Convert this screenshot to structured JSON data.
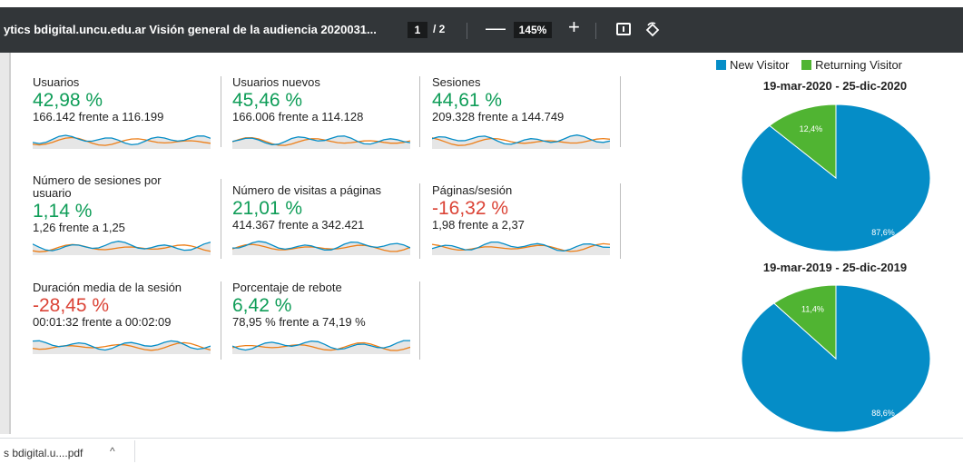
{
  "toolbar": {
    "title": "ytics bdigital.uncu.edu.ar Visión general de la audiencia 2020031...",
    "page_current": "1",
    "page_sep": "/ 2",
    "zoom": "145%",
    "zoom_out": "—",
    "zoom_in": "+"
  },
  "metrics": [
    {
      "label": "Usuarios",
      "pct": "42,98 %",
      "trend": "up",
      "comp": "166.142 frente a 116.199"
    },
    {
      "label": "Usuarios nuevos",
      "pct": "45,46 %",
      "trend": "up",
      "comp": "166.006 frente a 114.128"
    },
    {
      "label": "Sesiones",
      "pct": "44,61 %",
      "trend": "up",
      "comp": "209.328 frente a 144.749"
    },
    {
      "label": "Número de sesiones por usuario",
      "pct": "1,14 %",
      "trend": "up",
      "comp": "1,26 frente a 1,25"
    },
    {
      "label": "Número de visitas a páginas",
      "pct": "21,01 %",
      "trend": "up",
      "comp": "414.367 frente a 342.421"
    },
    {
      "label": "Páginas/sesión",
      "pct": "-16,32 %",
      "trend": "down",
      "comp": "1,98 frente a 2,37"
    },
    {
      "label": "Duración media de la sesión",
      "pct": "-28,45 %",
      "trend": "down",
      "comp": "00:01:32 frente a 00:02:09"
    },
    {
      "label": "Porcentaje de rebote",
      "pct": "6,42 %",
      "trend": "up",
      "comp": "78,95 % frente a 74,19 %"
    }
  ],
  "legend": {
    "new": "New Visitor",
    "returning": "Returning Visitor"
  },
  "colors": {
    "new": "#058dc7",
    "returning": "#50b432",
    "up": "#0f9d58",
    "down": "#db4437",
    "spark_blue": "#058dc7",
    "spark_orange": "#ed7e17"
  },
  "pies": [
    {
      "title": "19-mar-2020 - 25-dic-2020",
      "new": 87.6,
      "returning": 12.4,
      "new_label": "87,6%",
      "returning_label": "12,4%"
    },
    {
      "title": "19-mar-2019 - 25-dic-2019",
      "new": 88.6,
      "returning": 11.4,
      "new_label": "88,6%",
      "returning_label": "11,4%"
    }
  ],
  "download": {
    "filename": "s bdigital.u....pdf",
    "chevron": "^"
  }
}
